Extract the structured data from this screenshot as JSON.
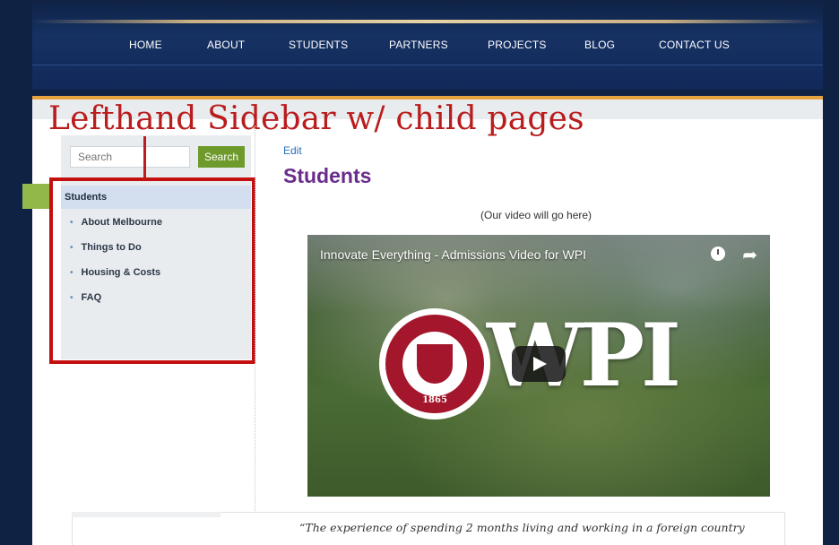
{
  "nav": {
    "items": [
      "HOME",
      "ABOUT",
      "STUDENTS",
      "PARTNERS",
      "PROJECTS",
      "BLOG",
      "CONTACT US"
    ]
  },
  "annotation": {
    "label": "Lefthand Sidebar w/ child pages"
  },
  "sidebar": {
    "search_placeholder": "Search",
    "search_button": "Search",
    "header": "Students",
    "items": [
      "About Melbourne",
      "Things to Do",
      "Housing & Costs",
      "FAQ"
    ]
  },
  "main": {
    "edit_link": "Edit",
    "title": "Students",
    "video_caption": "(Our video will go here)",
    "video": {
      "title": "Innovate Everything - Admissions Video for WPI",
      "logo_text": "WPI",
      "seal_year": "1865"
    },
    "quote": "“The experience of spending 2 months living and working in a foreign country"
  },
  "colors": {
    "nav_bg": "#0f2244",
    "accent_orange": "#e6a23c",
    "annotation_red": "#c40f0f",
    "title_purple": "#6a2d8c",
    "search_green": "#6d9a2b"
  }
}
